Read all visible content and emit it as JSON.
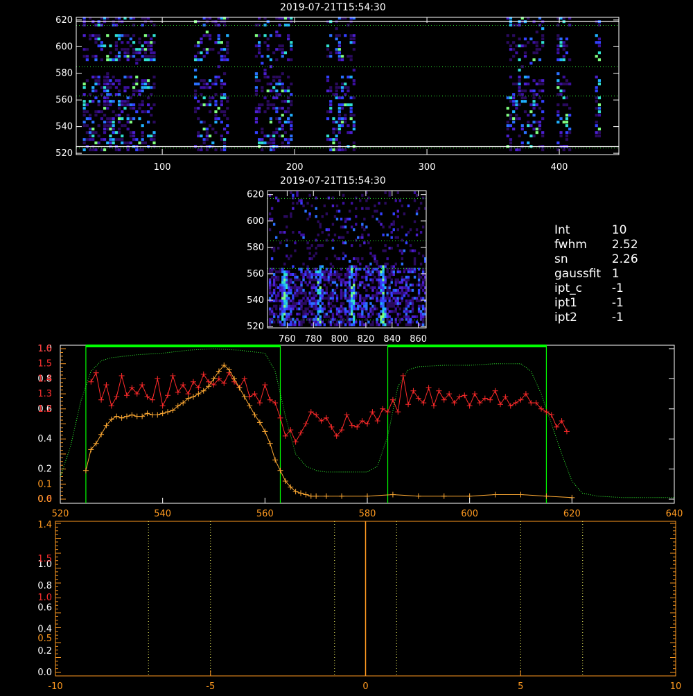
{
  "panels": {
    "top_title": "2019-07-21T15:54:30",
    "mid_title": "2019-07-21T15:54:30"
  },
  "info": {
    "rows": [
      {
        "key": "Int",
        "value": "10"
      },
      {
        "key": "fwhm",
        "value": "2.52"
      },
      {
        "key": "sn",
        "value": "2.26"
      },
      {
        "key": "gaussfit",
        "value": "1"
      },
      {
        "key": "ipt_c",
        "value": "-1"
      },
      {
        "key": "ipt1",
        "value": "-1"
      },
      {
        "key": "ipt2",
        "value": "-1"
      }
    ]
  },
  "colors": {
    "axes": "#ffffff",
    "green_dotted": "#33ff33",
    "green_line": "#00ff00",
    "red": "#ff2a2a",
    "orange": "#ffaa33",
    "axis_red": "#ff3030",
    "axis_orange": "#ff9a20",
    "yellow_dotted": "#ffff66"
  },
  "chart_data": [
    {
      "type": "heatmap",
      "title": "2019-07-21T15:54:30",
      "xlim": [
        35,
        445
      ],
      "ylim": [
        519,
        622
      ],
      "xticks": [
        100,
        200,
        300,
        400
      ],
      "yticks": [
        520,
        540,
        560,
        580,
        600,
        620
      ],
      "hlines_dotted": [
        524,
        563,
        585,
        616
      ],
      "hlines_solid": [
        525,
        619
      ],
      "data_bands_x": [
        [
          40,
          93
        ],
        [
          124,
          150
        ],
        [
          170,
          197
        ],
        [
          224,
          245
        ],
        [
          360,
          387
        ],
        [
          398,
          407
        ],
        [
          427,
          431
        ]
      ]
    },
    {
      "type": "heatmap",
      "title": "2019-07-21T15:54:30",
      "xlim": [
        745,
        866
      ],
      "ylim": [
        519,
        623
      ],
      "xticks": [
        760,
        780,
        800,
        820,
        840,
        860
      ],
      "yticks": [
        520,
        540,
        560,
        580,
        600,
        620
      ],
      "hlines_dotted": [
        525,
        564,
        585,
        617
      ],
      "bright_columns_x": [
        757,
        784,
        809,
        832
      ]
    },
    {
      "type": "line",
      "xlim": [
        520,
        640
      ],
      "xticks": [
        520,
        540,
        560,
        580,
        600,
        620,
        640
      ],
      "left_axis_white": {
        "ylim": [
          0.0,
          1.0
        ],
        "ticks": [
          0.0,
          0.2,
          0.4,
          0.6,
          0.8,
          1.0
        ]
      },
      "left_axis_red": {
        "ylim": [
          0.6,
          1.6
        ],
        "ticks": [
          0.6,
          1.2,
          1.3,
          1.4,
          1.5,
          1.6
        ]
      },
      "left_axis_orange": {
        "ticks": [
          0.0,
          0.1,
          0.2,
          0.4,
          0.6,
          0.8,
          1.0
        ]
      },
      "windows": [
        [
          525,
          563
        ],
        [
          584,
          615
        ]
      ],
      "series": [
        {
          "name": "",
          "style": "dotted",
          "color": "green",
          "x": [
            520,
            522,
            524,
            526,
            528,
            530,
            535,
            540,
            545,
            550,
            555,
            560,
            562,
            564,
            566,
            568,
            570,
            572,
            575,
            580,
            582,
            584,
            586,
            588,
            590,
            595,
            600,
            605,
            610,
            612,
            614,
            616,
            618,
            620,
            622,
            625,
            630,
            635,
            640
          ],
          "y": [
            0.15,
            0.35,
            0.65,
            0.85,
            0.92,
            0.94,
            0.96,
            0.97,
            0.99,
            1.0,
            0.99,
            0.97,
            0.85,
            0.55,
            0.3,
            0.22,
            0.19,
            0.18,
            0.18,
            0.18,
            0.22,
            0.42,
            0.75,
            0.86,
            0.88,
            0.89,
            0.89,
            0.9,
            0.9,
            0.85,
            0.7,
            0.5,
            0.3,
            0.12,
            0.04,
            0.02,
            0.01,
            0.01,
            0.01
          ]
        },
        {
          "name": "",
          "style": "line-plus",
          "color": "red",
          "x": [
            526,
            527,
            528,
            529,
            530,
            531,
            532,
            533,
            534,
            535,
            536,
            537,
            538,
            539,
            540,
            541,
            542,
            543,
            544,
            545,
            546,
            547,
            548,
            549,
            550,
            551,
            552,
            553,
            554,
            555,
            556,
            557,
            558,
            559,
            560,
            561,
            562,
            563,
            564,
            565,
            566,
            567,
            568,
            569,
            570,
            571,
            572,
            573,
            574,
            575,
            576,
            577,
            578,
            579,
            580,
            581,
            582,
            583,
            584,
            585,
            586,
            587,
            588,
            589,
            590,
            591,
            592,
            593,
            594,
            595,
            596,
            597,
            598,
            599,
            600,
            601,
            602,
            603,
            604,
            605,
            606,
            607,
            608,
            609,
            610,
            611,
            612,
            613,
            614,
            615,
            616,
            617,
            618,
            619
          ],
          "y": [
            1.38,
            1.44,
            1.26,
            1.36,
            1.22,
            1.28,
            1.42,
            1.29,
            1.34,
            1.3,
            1.36,
            1.28,
            1.26,
            1.4,
            1.22,
            1.29,
            1.42,
            1.31,
            1.36,
            1.3,
            1.38,
            1.34,
            1.43,
            1.38,
            1.36,
            1.4,
            1.37,
            1.44,
            1.38,
            1.34,
            1.4,
            1.28,
            1.3,
            1.24,
            1.36,
            1.26,
            1.24,
            1.14,
            1.02,
            1.06,
            0.98,
            1.04,
            1.1,
            1.18,
            1.16,
            1.12,
            1.14,
            1.08,
            1.02,
            1.06,
            1.16,
            1.09,
            1.08,
            1.12,
            1.1,
            1.18,
            1.12,
            1.2,
            1.18,
            1.26,
            1.18,
            1.42,
            1.23,
            1.32,
            1.27,
            1.24,
            1.34,
            1.22,
            1.32,
            1.26,
            1.3,
            1.24,
            1.28,
            1.29,
            1.22,
            1.3,
            1.24,
            1.27,
            1.26,
            1.32,
            1.23,
            1.28,
            1.22,
            1.24,
            1.26,
            1.3,
            1.24,
            1.24,
            1.2,
            1.18,
            1.16,
            1.08,
            1.12,
            1.05
          ]
        },
        {
          "name": "",
          "style": "line-plus",
          "color": "orange",
          "x": [
            525,
            526,
            527,
            528,
            529,
            530,
            531,
            532,
            533,
            534,
            535,
            536,
            537,
            538,
            539,
            540,
            541,
            542,
            543,
            544,
            545,
            546,
            547,
            548,
            549,
            550,
            551,
            552,
            553,
            554,
            555,
            556,
            557,
            558,
            559,
            560,
            561,
            562,
            563,
            564,
            565,
            566,
            567,
            568,
            569,
            570,
            572,
            575,
            580,
            585,
            590,
            595,
            600,
            605,
            610,
            615,
            620
          ],
          "y": [
            0.19,
            0.33,
            0.37,
            0.43,
            0.49,
            0.53,
            0.55,
            0.54,
            0.55,
            0.56,
            0.55,
            0.55,
            0.57,
            0.56,
            0.56,
            0.57,
            0.58,
            0.59,
            0.62,
            0.64,
            0.67,
            0.68,
            0.7,
            0.72,
            0.75,
            0.8,
            0.85,
            0.89,
            0.86,
            0.8,
            0.74,
            0.68,
            0.62,
            0.56,
            0.51,
            0.45,
            0.37,
            0.26,
            0.19,
            0.12,
            0.08,
            0.05,
            0.04,
            0.03,
            0.02,
            0.02,
            0.02,
            0.02,
            0.02,
            0.03,
            0.02,
            0.02,
            0.02,
            0.03,
            0.03,
            0.02,
            0.01
          ]
        }
      ]
    },
    {
      "type": "line",
      "xlim": [
        -10,
        10
      ],
      "xticks": [
        -10,
        -5,
        0,
        5,
        10
      ],
      "left_axis_white": {
        "ylim": [
          0.0,
          1.0
        ],
        "ticks": [
          0.0,
          0.2,
          0.4,
          0.6,
          0.8,
          1.0
        ]
      },
      "left_axis_red": {
        "ticks": [
          1.0,
          1.5
        ]
      },
      "left_axis_orange": {
        "ticks": [
          0.5,
          1.4
        ]
      },
      "dotted_vlines": [
        -7,
        -5,
        -1,
        1,
        5,
        7
      ],
      "center_vline": 0,
      "series": []
    }
  ]
}
